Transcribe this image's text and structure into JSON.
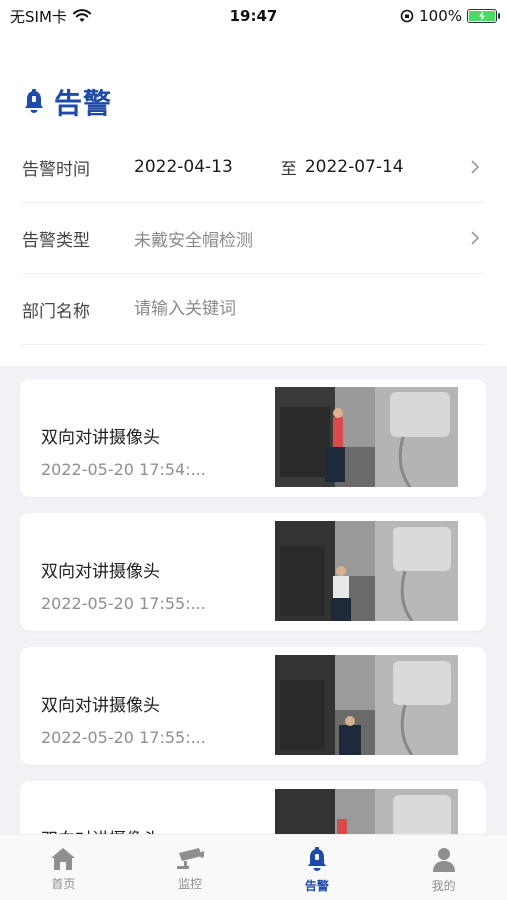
{
  "status_bar": {
    "carrier": "无SIM卡",
    "time": "19:47",
    "battery": "100%"
  },
  "page": {
    "title": "告警"
  },
  "filters": {
    "time_label": "告警时间",
    "start_date": "2022-04-13",
    "range_sep": "至",
    "end_date": "2022-07-14",
    "type_label": "告警类型",
    "type_value": "未戴安全帽检测",
    "dept_label": "部门名称",
    "dept_placeholder": "请输入关键词"
  },
  "alerts": [
    {
      "title": "双向对讲摄像头",
      "time": "2022-05-20 17:54:..."
    },
    {
      "title": "双向对讲摄像头",
      "time": "2022-05-20 17:55:..."
    },
    {
      "title": "双向对讲摄像头",
      "time": "2022-05-20 17:55:..."
    },
    {
      "title": "双向对讲摄像头",
      "time": ""
    }
  ],
  "tabs": [
    {
      "label": "首页",
      "icon": "home-icon"
    },
    {
      "label": "监控",
      "icon": "camera-icon"
    },
    {
      "label": "告警",
      "icon": "alarm-bell-icon"
    },
    {
      "label": "我的",
      "icon": "user-icon"
    }
  ],
  "colors": {
    "accent": "#1f4aa8",
    "inactive": "#8f8f8f",
    "list_bg": "#f2f2f6"
  }
}
